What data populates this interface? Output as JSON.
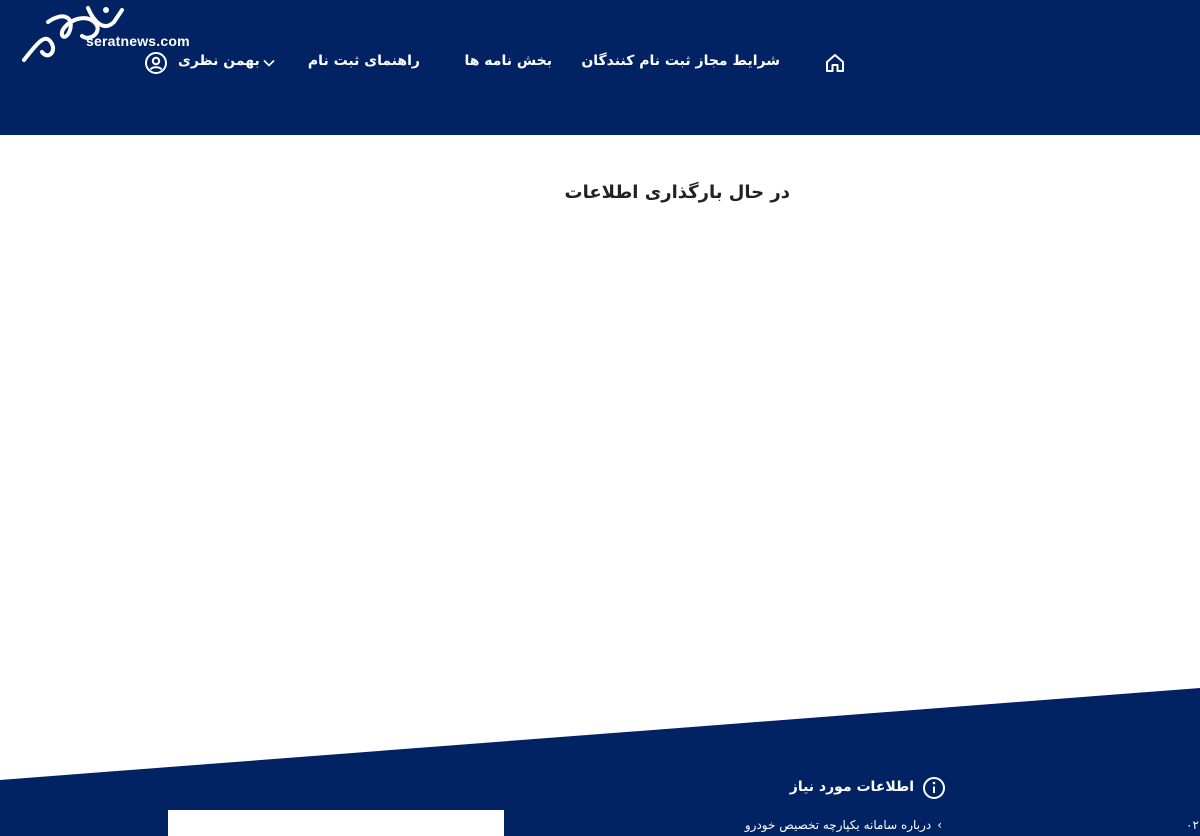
{
  "header": {
    "logo_text": "صراط",
    "logo_url": "seratnews.com",
    "nav": {
      "home_icon": "home-icon",
      "item1": "شرایط مجاز ثبت نام کنندگان",
      "item2": "بخش نامه ها",
      "item3": "راهنمای ثبت نام"
    },
    "user": {
      "name": "بهمن نظری",
      "icon": "user-circle-icon",
      "chevron": "chevron-down-icon"
    }
  },
  "main": {
    "loading_text": "در حال بارگذاری اطلاعات"
  },
  "footer": {
    "info_icon": "info-icon",
    "info_title": "اطلاعات مورد نیاز",
    "link1": "درباره سامانه یکپارچه تخصیص خودرو",
    "link_chevron": "›",
    "edge_text": "۰۲"
  },
  "colors": {
    "header_bg": "#022363",
    "footer_bg": "#022363",
    "text_dark": "#222222",
    "text_light": "#ffffff"
  }
}
